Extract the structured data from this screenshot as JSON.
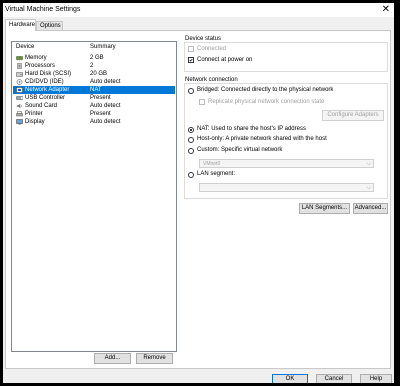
{
  "window": {
    "title": "Virtual Machine Settings",
    "close_glyph": "✕"
  },
  "tabs": [
    {
      "label": "Hardware"
    },
    {
      "label": "Options"
    }
  ],
  "device_list": {
    "headers": {
      "device": "Device",
      "summary": "Summary"
    },
    "rows": [
      {
        "device": "Memory",
        "summary": "2 GB",
        "icon": "memory-icon",
        "selected": false
      },
      {
        "device": "Processors",
        "summary": "2",
        "icon": "processor-icon",
        "selected": false
      },
      {
        "device": "Hard Disk (SCSI)",
        "summary": "20 GB",
        "icon": "hard-disk-icon",
        "selected": false
      },
      {
        "device": "CD/DVD (IDE)",
        "summary": "Auto detect",
        "icon": "cd-dvd-icon",
        "selected": false
      },
      {
        "device": "Network Adapter",
        "summary": "NAT",
        "icon": "network-adapter-icon",
        "selected": true
      },
      {
        "device": "USB Controller",
        "summary": "Present",
        "icon": "usb-icon",
        "selected": false
      },
      {
        "device": "Sound Card",
        "summary": "Auto detect",
        "icon": "sound-card-icon",
        "selected": false
      },
      {
        "device": "Printer",
        "summary": "Present",
        "icon": "printer-icon",
        "selected": false
      },
      {
        "device": "Display",
        "summary": "Auto detect",
        "icon": "display-icon",
        "selected": false
      }
    ]
  },
  "list_buttons": {
    "add": "Add...",
    "remove": "Remove"
  },
  "device_status": {
    "title": "Device status",
    "connected": {
      "label": "Connected",
      "checked": false,
      "enabled": false
    },
    "connect_at_power_on": {
      "label": "Connect at power on",
      "checked": true
    }
  },
  "network_connection": {
    "title": "Network connection",
    "bridged": {
      "label": "Bridged: Connected directly to the physical network",
      "selected": false
    },
    "replicate": {
      "label": "Replicate physical network connection state",
      "checked": false,
      "enabled": false
    },
    "configure_adapters": "Configure Adapters",
    "nat": {
      "label": "NAT: Used to share the host's IP address",
      "selected": true
    },
    "host_only": {
      "label": "Host-only: A private network shared with the host",
      "selected": false
    },
    "custom": {
      "label": "Custom: Specific virtual network",
      "selected": false
    },
    "custom_value": "VMnet0",
    "lan_segment": {
      "label": "LAN segment:",
      "selected": false
    },
    "lan_segment_value": ""
  },
  "network_buttons": {
    "lan_segments": "LAN Segments...",
    "advanced": "Advanced..."
  },
  "dialog_buttons": {
    "ok": "OK",
    "cancel": "Cancel",
    "help": "Help"
  }
}
